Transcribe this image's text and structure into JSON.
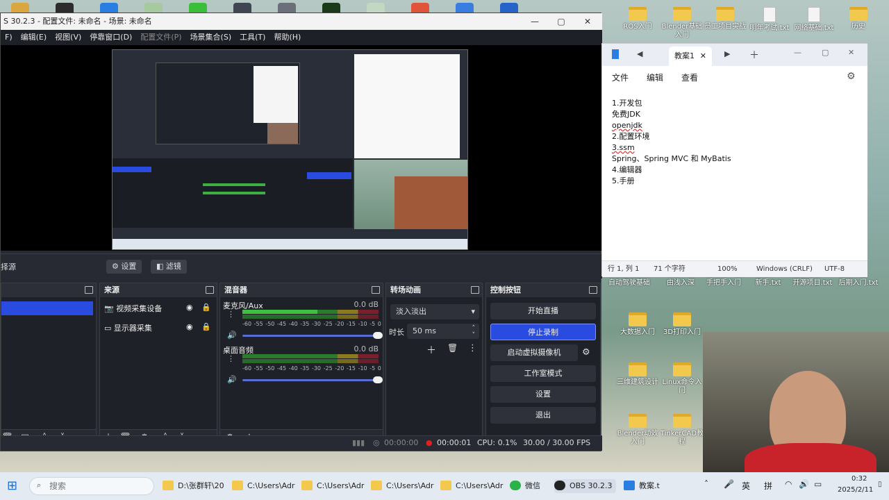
{
  "desktop": {
    "icons_right": [
      {
        "label": "ROS入门"
      },
      {
        "label": "Blender基础入门"
      },
      {
        "label": "员工项目实战"
      },
      {
        "label": "明年考试.txt"
      },
      {
        "label": "网络基础.txt"
      },
      {
        "label": "历史"
      }
    ],
    "icons_row2": [
      {
        "label": "自动驾驶基础"
      },
      {
        "label": "由浅入深"
      },
      {
        "label": "手把手入门"
      },
      {
        "label": "新手.txt"
      },
      {
        "label": "开源项目.txt"
      },
      {
        "label": "后期入门.txt"
      }
    ],
    "icons_row3": [
      {
        "label": "大数据入门"
      },
      {
        "label": "3D打印入门"
      }
    ],
    "icons_row4": [
      {
        "label": "三维建筑设计"
      },
      {
        "label": "Linux命令入门"
      }
    ],
    "icons_row5": [
      {
        "label": "Blender动效入门"
      },
      {
        "label": "TinkerCAD教程"
      }
    ]
  },
  "obs": {
    "title": "S 30.2.3 - 配置文件: 未命名 - 场景: 未命名",
    "window_controls": {
      "minimize": "—",
      "maximize": "▢",
      "close": "✕"
    },
    "menu": [
      {
        "label": "F)",
        "disabled": false
      },
      {
        "label": "编辑(E)",
        "disabled": false
      },
      {
        "label": "视图(V)",
        "disabled": false
      },
      {
        "label": "停靠窗口(D)",
        "disabled": false
      },
      {
        "label": "配置文件(P)",
        "disabled": true
      },
      {
        "label": "场景集合(S)",
        "disabled": false
      },
      {
        "label": "工具(T)",
        "disabled": false
      },
      {
        "label": "帮助(H)",
        "disabled": false
      }
    ],
    "source_bar": {
      "left_label": "择源",
      "settings_label": "设置",
      "filters_label": "滤镜"
    },
    "scenes_dock": {
      "title": ""
    },
    "sources_dock": {
      "title": "来源",
      "items": [
        {
          "label": "视频采集设备",
          "icon": "camera-icon"
        },
        {
          "label": "显示器采集",
          "icon": "monitor-icon"
        }
      ]
    },
    "mixer_dock": {
      "title": "混音器",
      "channels": [
        {
          "name": "麦克风/Aux",
          "db": "0.0 dB"
        },
        {
          "name": "桌面音频",
          "db": "0.0 dB"
        }
      ],
      "scale": [
        "-60",
        "-55",
        "-50",
        "-45",
        "-40",
        "-35",
        "-30",
        "-25",
        "-20",
        "-15",
        "-10",
        "-5",
        "0"
      ]
    },
    "transitions_dock": {
      "title": "转场动画",
      "selected": "淡入淡出",
      "duration_label": "时长",
      "duration_value": "50 ms"
    },
    "controls_dock": {
      "title": "控制按钮",
      "buttons": [
        {
          "label": "开始直播",
          "active": false
        },
        {
          "label": "停止录制",
          "active": true
        },
        {
          "label": "启动虚拟摄像机",
          "active": false
        },
        {
          "label": "工作室模式",
          "active": false
        },
        {
          "label": "设置",
          "active": false
        },
        {
          "label": "退出",
          "active": false
        }
      ]
    },
    "status": {
      "stream_time": "00:00:00",
      "record_time": "00:00:01",
      "cpu": "CPU: 0.1%",
      "fps": "30.00 / 30.00 FPS"
    }
  },
  "notepad": {
    "tab_title": "教案1",
    "menu": [
      "文件",
      "编辑",
      "查看"
    ],
    "lines": [
      "1.开发包",
      "免费JDK",
      "openjdk",
      "2.配置环境",
      "3.ssm",
      "Spring、Spring MVC 和 MyBatis",
      "4.编辑器",
      "5.手册"
    ],
    "status": {
      "position": "行 1, 列 1",
      "chars": "71 个字符",
      "zoom": "100%",
      "eol": "Windows (CRLF)",
      "encoding": "UTF-8"
    }
  },
  "taskbar": {
    "search_placeholder": "搜索",
    "items": [
      {
        "label": "D:\\张群轩\\20"
      },
      {
        "label": "C:\\Users\\Adr"
      },
      {
        "label": "C:\\Users\\Adr"
      },
      {
        "label": "C:\\Users\\Adr"
      },
      {
        "label": "C:\\Users\\Adr"
      },
      {
        "label": "微信"
      },
      {
        "label": "OBS 30.2.3"
      },
      {
        "label": "教案.t"
      }
    ],
    "tray": {
      "lang": "英",
      "ime": "拼",
      "time": "0:32",
      "date": "2025/2/11"
    }
  }
}
